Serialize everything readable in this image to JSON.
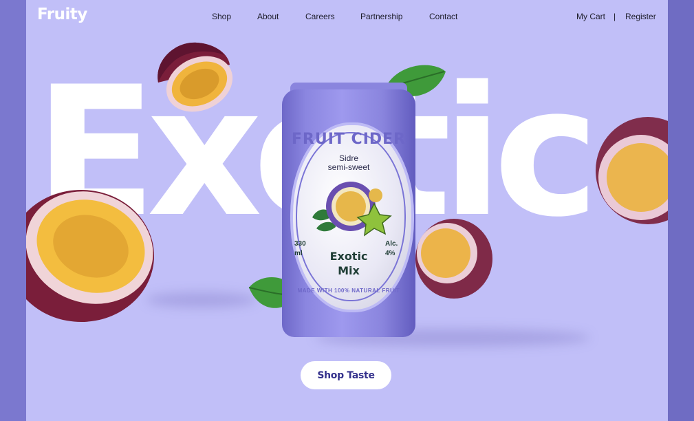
{
  "brand": {
    "logo": "Fruity"
  },
  "nav": {
    "items": [
      "Shop",
      "About",
      "Careers",
      "Partnership",
      "Contact"
    ]
  },
  "account": {
    "cart": "My Cart",
    "separator": "|",
    "register": "Register"
  },
  "hero": {
    "background_word": "Exotic",
    "cta": "Shop Taste"
  },
  "product": {
    "brand_line": "FRUIT CIDER",
    "variety_1": "Sidre",
    "variety_2": "semi-sweet",
    "name_1": "Exotic",
    "name_2": "Mix",
    "volume_1": "330",
    "volume_2": "ml",
    "alcohol_1": "Alc.",
    "alcohol_2": "4%",
    "tagline": "MADE WITH 100% NATURAL FRUIT"
  },
  "colors": {
    "background": "#c1bff8",
    "can": "#8b86e0",
    "accent_dark": "#34318c",
    "fruit_skin": "#7a1e3a",
    "fruit_pulp": "#f2b53a"
  }
}
